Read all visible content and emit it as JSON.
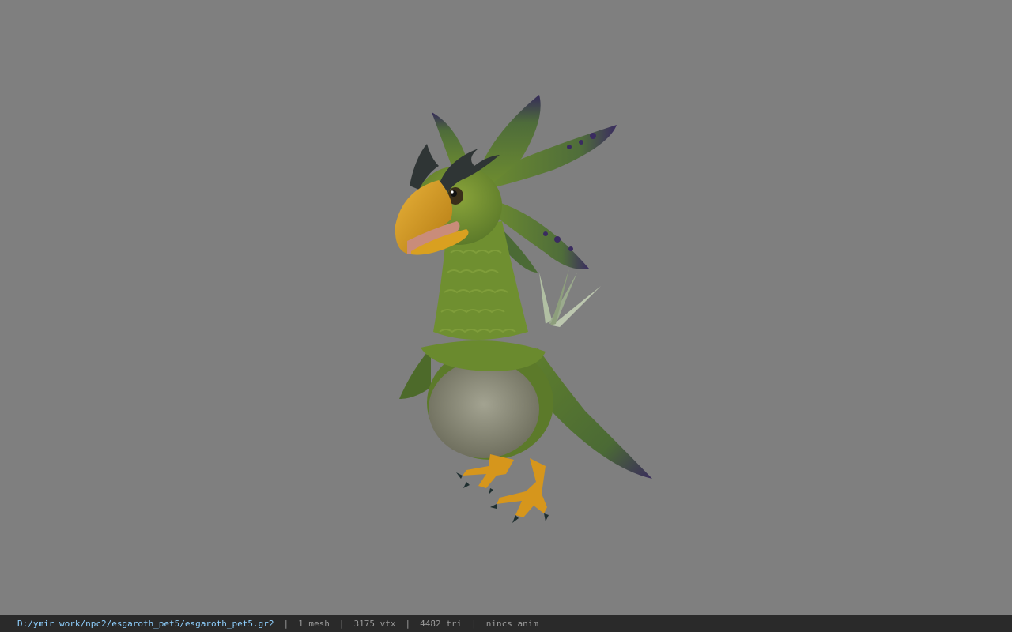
{
  "viewport": {
    "background_color": "#7f7f7f",
    "model_name": "esgaroth_pet5"
  },
  "statusbar": {
    "file_path": "D:/ymir work/npc2/esgaroth_pet5/esgaroth_pet5.gr2",
    "separator": "|",
    "mesh_count": "1 mesh",
    "vertex_count": "3175 vtx",
    "triangle_count": "4482 tri",
    "anim_status": "nincs anim"
  },
  "colors": {
    "feather_green": "#6e8a2f",
    "belly_gray": "#8e8e7a",
    "beak_orange": "#d9a020",
    "tip_purple": "#3b2a5e",
    "path_text": "#8fd0ff"
  }
}
